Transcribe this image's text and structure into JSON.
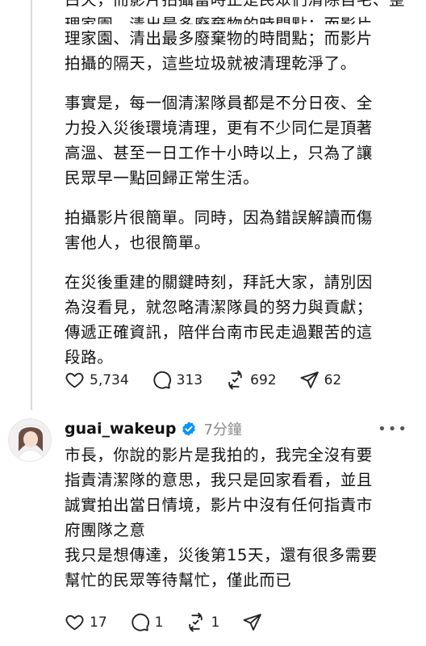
{
  "post1": {
    "clipped_line": "白天，而影片拍攝當時正是民眾們清除自宅、整理家園、清出最多廢棄物的時間點；而影片",
    "paragraphs": [
      "理家園、清出最多廢棄物的時間點；而影片\n拍攝的隔天，這些垃圾就被清理乾淨了。",
      "事實是，每一個清潔隊員都是不分日夜、全\n力投入災後環境清理，更有不少同仁是頂著\n高溫、甚至一日工作十小時以上，只為了讓\n民眾早一點回歸正常生活。",
      "拍攝影片很簡單。同時，因為錯誤解讀而傷\n害他人，也很簡單。",
      "在災後重建的關鍵時刻，拜託大家，請別因\n為沒看見，就忽略清潔隊員的努力與貢獻；\n傳遞正確資訊，陪伴台南市民走過艱苦的這\n段路。"
    ],
    "stats": {
      "likes": "5,734",
      "replies": "313",
      "reposts": "692",
      "shares": "62"
    }
  },
  "reply": {
    "username": "guai_wakeup",
    "time": "7分鐘",
    "text": "市長，你說的影片是我拍的，我完全沒有要\n指責清潔隊的意思，我只是回家看看，並且\n誠實拍出當日情境，影片中沒有任何指責市\n府團隊之意\n我只是想傳達，災後第15天，還有很多需要\n幫忙的民眾等待幫忙，僅此而已",
    "stats": {
      "likes": "17",
      "replies": "1",
      "reposts": "1"
    }
  },
  "icons": [
    "heart-icon",
    "comment-icon",
    "repost-icon",
    "share-icon",
    "verified-badge-icon",
    "more-icon"
  ],
  "colors": {
    "text": "#111111",
    "muted": "#8a8a8a",
    "verified": "#0095f6"
  }
}
